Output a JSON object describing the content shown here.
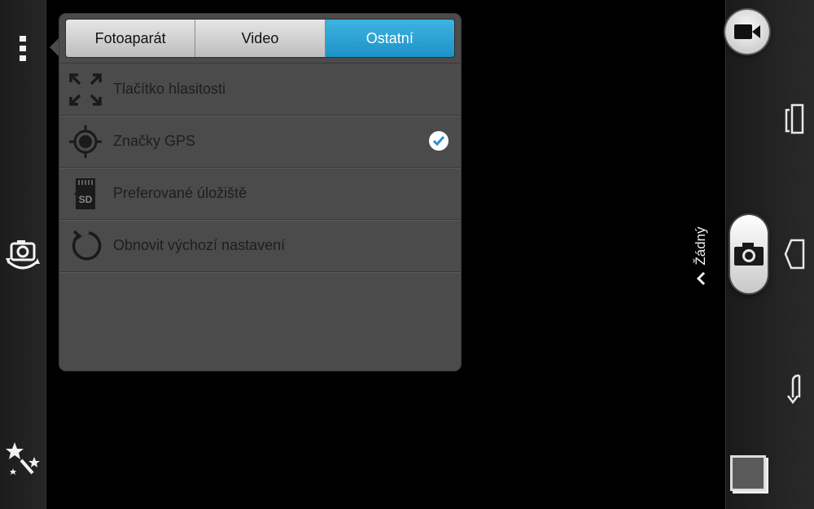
{
  "tabs": [
    {
      "label": "Fotoaparát",
      "active": false
    },
    {
      "label": "Video",
      "active": false
    },
    {
      "label": "Ostatní",
      "active": true
    }
  ],
  "settings": [
    {
      "label": "Tlačítko hlasitosti",
      "icon": "expand-arrows-icon",
      "checked": null
    },
    {
      "label": "Značky GPS",
      "icon": "gps-target-icon",
      "checked": true
    },
    {
      "label": "Preferované úložiště",
      "icon": "sd-card-icon",
      "checked": null
    },
    {
      "label": "Obnovit výchozí nastavení",
      "icon": "reset-icon",
      "checked": null
    }
  ],
  "timer": {
    "label": "Žádný"
  },
  "sd_text": "SD",
  "colors": {
    "active_tab": "#33a8db",
    "popup_bg": "#4b4b4b",
    "check": "#2b8fd0"
  }
}
